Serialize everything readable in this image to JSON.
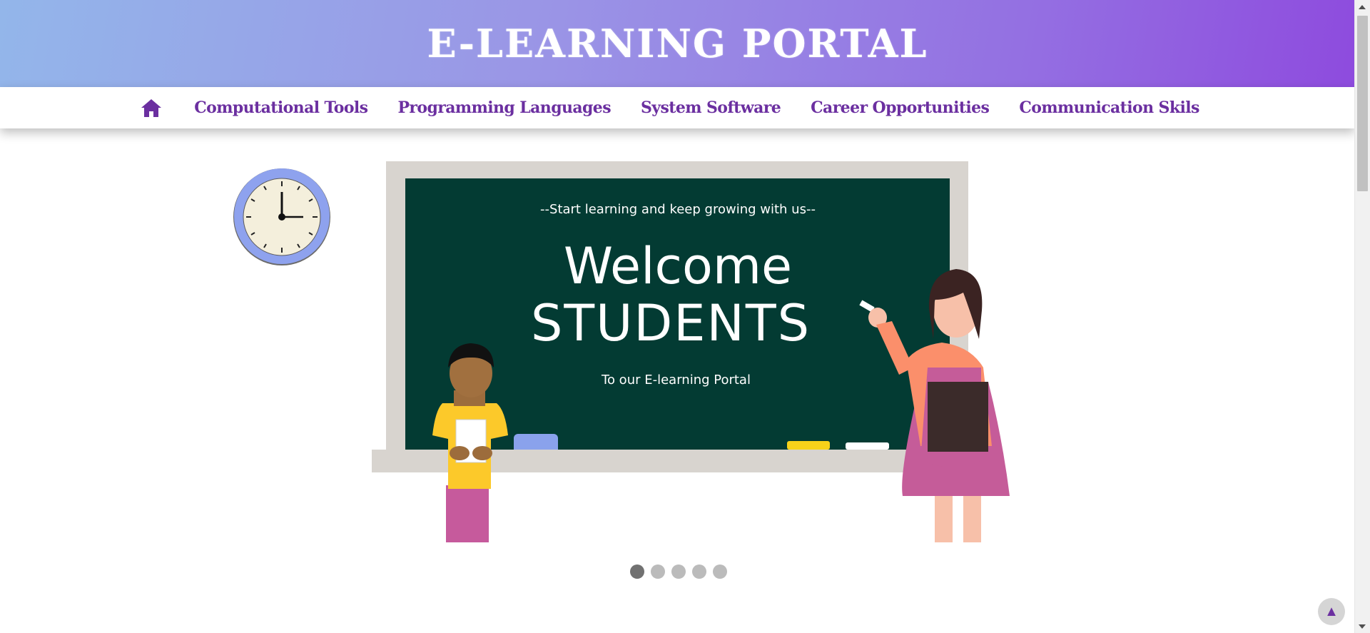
{
  "header": {
    "title": "E-LEARNING PORTAL"
  },
  "nav": {
    "home_icon": "home-icon",
    "items": [
      {
        "label": "Computational Tools"
      },
      {
        "label": "Programming Languages"
      },
      {
        "label": "System Software"
      },
      {
        "label": "Career Opportunities"
      },
      {
        "label": "Communication Skils"
      }
    ]
  },
  "slideshow": {
    "current_slide": 1,
    "slide_count": 5,
    "slide": {
      "tagline": "--Start learning and keep growing with us--",
      "heading_line1": "Welcome",
      "heading_line2": "STUDENTS",
      "subtext": "To our E-learning Portal"
    }
  },
  "back_to_top": {
    "icon": "▲"
  },
  "colors": {
    "header_gradient_start": "#93b6ea",
    "header_gradient_end": "#8e4bde",
    "nav_link": "#6b2fa0",
    "chalkboard": "#033b33",
    "dot_active": "#717171",
    "dot_inactive": "#bbbbbb"
  }
}
